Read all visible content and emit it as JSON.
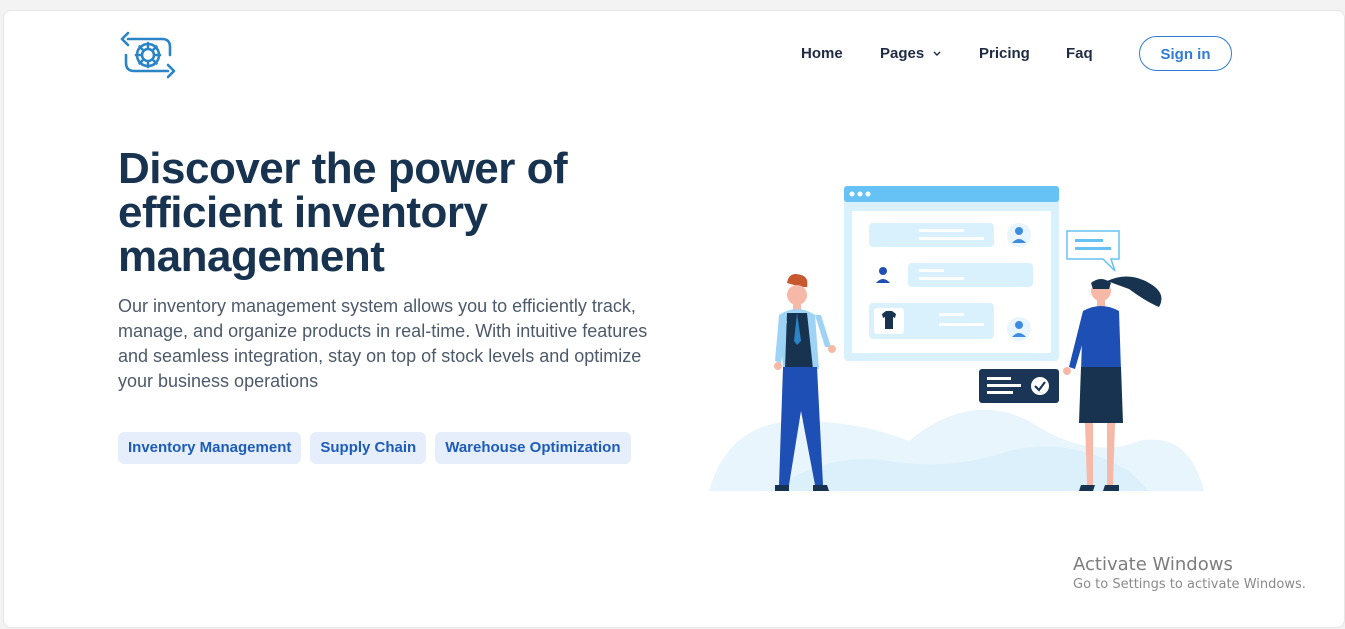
{
  "nav": {
    "home": "Home",
    "pages": "Pages",
    "pricing": "Pricing",
    "faq": "Faq",
    "signin": "Sign in"
  },
  "hero": {
    "headline_line1": "Discover the power of",
    "headline_line2": "efficient inventory",
    "headline_line3": "management",
    "description": "Our inventory management system allows you to efficiently track, manage, and organize products in real-time. With intuitive features and seamless integration, stay on top of stock levels and optimize your business operations",
    "tags": [
      "Inventory Management",
      "Supply Chain",
      "Warehouse Optimization"
    ]
  },
  "watermark": {
    "title": "Activate Windows",
    "subtitle": "Go to Settings to activate Windows."
  },
  "icons": {
    "logo": "sync-gear-icon",
    "pages_chevron": "chevron-down-icon",
    "user": "user-icon",
    "tshirt": "tshirt-icon",
    "check": "check-icon",
    "chat": "chat-bubble-icon"
  },
  "colors": {
    "primary": "#2f7bd6",
    "heading": "#17334f",
    "tag_bg": "#e5eefa",
    "tag_text": "#1d5cb8",
    "illustration_blue": "#66c2f5"
  }
}
